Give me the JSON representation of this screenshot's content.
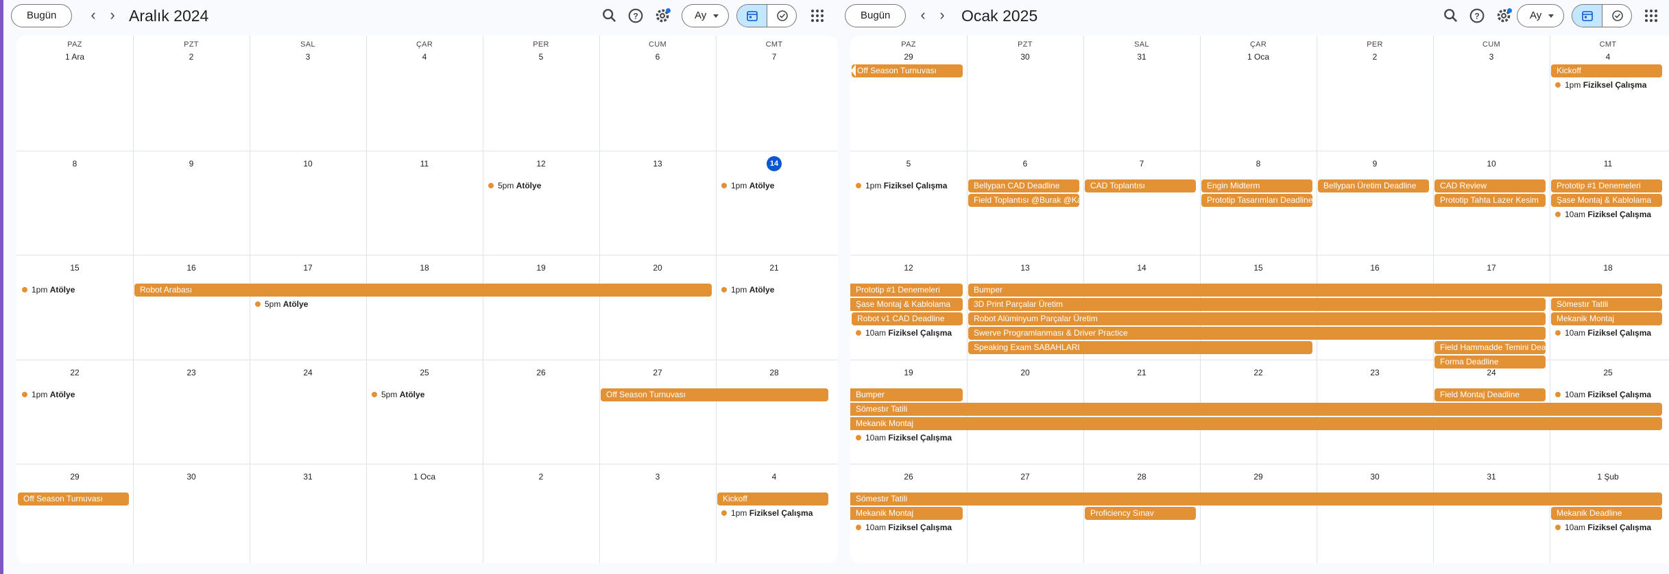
{
  "left": {
    "toolbar": {
      "today_label": "Bugün",
      "month_title": "Aralık 2024",
      "view_label": "Ay",
      "icons": [
        "search-icon",
        "help-icon",
        "settings-icon",
        "calendar-view-icon",
        "tasks-view-icon",
        "apps-grid-icon"
      ]
    },
    "weekdays": [
      "PAZ",
      "PZT",
      "SAL",
      "ÇAR",
      "PER",
      "CUM",
      "CMT"
    ],
    "weeks": [
      [
        "1 Ara",
        "2",
        "3",
        "4",
        "5",
        "6",
        "7"
      ],
      [
        "8",
        "9",
        "10",
        "11",
        "12",
        "13",
        "14"
      ],
      [
        "15",
        "16",
        "17",
        "18",
        "19",
        "20",
        "21"
      ],
      [
        "22",
        "23",
        "24",
        "25",
        "26",
        "27",
        "28"
      ],
      [
        "29",
        "30",
        "31",
        "1 Oca",
        "2",
        "3",
        "4"
      ]
    ],
    "today": {
      "week": 1,
      "day": 6
    },
    "bars": [
      {
        "title": "Robot Arabası",
        "week": 2,
        "start": 1,
        "end": 5,
        "slot": 0
      },
      {
        "title": "Off Season Turnuvası",
        "week": 3,
        "start": 5,
        "end": 6,
        "slot": 0
      },
      {
        "title": "Off Season Turnuvası",
        "week": 4,
        "start": 0,
        "end": 0,
        "slot": 0
      },
      {
        "title": "Kickoff",
        "week": 4,
        "start": 6,
        "end": 6,
        "slot": 0
      }
    ],
    "dots": [
      {
        "time": "5pm",
        "title": "Atölye",
        "week": 1,
        "day": 4,
        "slot": 0
      },
      {
        "time": "1pm",
        "title": "Atölye",
        "week": 1,
        "day": 6,
        "slot": 0
      },
      {
        "time": "1pm",
        "title": "Atölye",
        "week": 2,
        "day": 0,
        "slot": 0
      },
      {
        "time": "5pm",
        "title": "Atölye",
        "week": 2,
        "day": 2,
        "slot": 1
      },
      {
        "time": "1pm",
        "title": "Atölye",
        "week": 2,
        "day": 6,
        "slot": 0
      },
      {
        "time": "1pm",
        "title": "Atölye",
        "week": 3,
        "day": 0,
        "slot": 0
      },
      {
        "time": "5pm",
        "title": "Atölye",
        "week": 3,
        "day": 3,
        "slot": 0
      },
      {
        "time": "1pm",
        "title": "Fiziksel Çalışma",
        "week": 4,
        "day": 6,
        "slot": 1
      }
    ]
  },
  "right": {
    "toolbar": {
      "today_label": "Bugün",
      "month_title": "Ocak 2025",
      "view_label": "Ay",
      "icons": [
        "search-icon",
        "help-icon",
        "settings-icon",
        "calendar-view-icon",
        "tasks-view-icon",
        "apps-grid-icon"
      ]
    },
    "weekdays": [
      "PAZ",
      "PZT",
      "SAL",
      "ÇAR",
      "PER",
      "CUM",
      "CMT"
    ],
    "weeks": [
      [
        "29",
        "30",
        "31",
        "1 Oca",
        "2",
        "3",
        "4"
      ],
      [
        "5",
        "6",
        "7",
        "8",
        "9",
        "10",
        "11"
      ],
      [
        "12",
        "13",
        "14",
        "15",
        "16",
        "17",
        "18"
      ],
      [
        "19",
        "20",
        "21",
        "22",
        "23",
        "24",
        "25"
      ],
      [
        "26",
        "27",
        "28",
        "29",
        "30",
        "31",
        "1 Şub"
      ]
    ],
    "bars": [
      {
        "title": "Off Season Turnuvası",
        "week": 0,
        "start": 0,
        "end": 0,
        "slot": 0,
        "arrow": true
      },
      {
        "title": "Kickoff",
        "week": 0,
        "start": 6,
        "end": 6,
        "slot": 0
      },
      {
        "title": "Bellypan CAD Deadline",
        "week": 1,
        "start": 1,
        "end": 1,
        "slot": 0
      },
      {
        "title": "Field Toplantısı @Burak @Kadir",
        "week": 1,
        "start": 1,
        "end": 1,
        "slot": 1
      },
      {
        "title": "CAD Toplantısı",
        "week": 1,
        "start": 2,
        "end": 2,
        "slot": 0
      },
      {
        "title": "Engin Midterm",
        "week": 1,
        "start": 3,
        "end": 3,
        "slot": 0
      },
      {
        "title": "Prototip Tasarımları Deadline",
        "week": 1,
        "start": 3,
        "end": 3,
        "slot": 1
      },
      {
        "title": "Bellypan Üretim Deadline",
        "week": 1,
        "start": 4,
        "end": 4,
        "slot": 0
      },
      {
        "title": "CAD Review",
        "week": 1,
        "start": 5,
        "end": 5,
        "slot": 0
      },
      {
        "title": "Prototip Tahta Lazer Kesim",
        "week": 1,
        "start": 5,
        "end": 5,
        "slot": 1
      },
      {
        "title": "Prototip #1 Denemeleri",
        "week": 1,
        "start": 6,
        "end": 6,
        "slot": 0
      },
      {
        "title": "Şase Montaj & Kablolama",
        "week": 1,
        "start": 6,
        "end": 6,
        "slot": 1
      },
      {
        "title": "Prototip #1 Denemeleri",
        "week": 2,
        "start": 0,
        "end": 0,
        "slot": 0,
        "contLeft": true
      },
      {
        "title": "Şase Montaj & Kablolama",
        "week": 2,
        "start": 0,
        "end": 0,
        "slot": 1,
        "contLeft": true
      },
      {
        "title": "Robot v1 CAD Deadline",
        "week": 2,
        "start": 0,
        "end": 0,
        "slot": 2
      },
      {
        "title": "Bumper",
        "week": 2,
        "start": 1,
        "end": 6,
        "slot": 0
      },
      {
        "title": "3D Print Parçalar Üretim",
        "week": 2,
        "start": 1,
        "end": 5,
        "slot": 1
      },
      {
        "title": "Robot Alüminyum Parçalar Üretim",
        "week": 2,
        "start": 1,
        "end": 5,
        "slot": 2
      },
      {
        "title": "Swerve Programlanması & Driver Practice",
        "week": 2,
        "start": 1,
        "end": 5,
        "slot": 3
      },
      {
        "title": "Speaking Exam SABAHLARI",
        "week": 2,
        "start": 1,
        "end": 3,
        "slot": 4
      },
      {
        "title": "Field Hammadde Temini Deadline",
        "week": 2,
        "start": 5,
        "end": 5,
        "slot": 4
      },
      {
        "title": "Forma Deadline",
        "week": 2,
        "start": 5,
        "end": 5,
        "slot": 5
      },
      {
        "title": "Sömestır Tatili",
        "week": 2,
        "start": 6,
        "end": 6,
        "slot": 1
      },
      {
        "title": "Mekanik Montaj",
        "week": 2,
        "start": 6,
        "end": 6,
        "slot": 2
      },
      {
        "title": "Bumper",
        "week": 3,
        "start": 0,
        "end": 0,
        "slot": 0,
        "contLeft": true
      },
      {
        "title": "Sömestır Tatili",
        "week": 3,
        "start": 0,
        "end": 6,
        "slot": 1,
        "contLeft": true
      },
      {
        "title": "Mekanik Montaj",
        "week": 3,
        "start": 0,
        "end": 6,
        "slot": 2,
        "contLeft": true
      },
      {
        "title": "Field Montaj Deadline",
        "week": 3,
        "start": 5,
        "end": 5,
        "slot": 0
      },
      {
        "title": "Sömestır Tatili",
        "week": 4,
        "start": 0,
        "end": 6,
        "slot": 0,
        "contLeft": true
      },
      {
        "title": "Mekanik Montaj",
        "week": 4,
        "start": 0,
        "end": 0,
        "slot": 1,
        "contLeft": true
      },
      {
        "title": "Proficiency Sınav",
        "week": 4,
        "start": 2,
        "end": 2,
        "slot": 1
      },
      {
        "title": "Mekanik Deadline",
        "week": 4,
        "start": 6,
        "end": 6,
        "slot": 1
      }
    ],
    "dots": [
      {
        "time": "1pm",
        "title": "Fiziksel Çalışma",
        "week": 0,
        "day": 6,
        "slot": 1
      },
      {
        "time": "1pm",
        "title": "Fiziksel Çalışma",
        "week": 1,
        "day": 0,
        "slot": 0
      },
      {
        "time": "10am",
        "title": "Fiziksel Çalışma",
        "week": 1,
        "day": 6,
        "slot": 2
      },
      {
        "time": "10am",
        "title": "Fiziksel Çalışma",
        "week": 2,
        "day": 0,
        "slot": 3
      },
      {
        "time": "10am",
        "title": "Fiziksel Çalışma",
        "week": 2,
        "day": 6,
        "slot": 3
      },
      {
        "time": "10am",
        "title": "Fiziksel Çalışma",
        "week": 3,
        "day": 0,
        "slot": 3
      },
      {
        "time": "10am",
        "title": "Fiziksel Çalışma",
        "week": 3,
        "day": 6,
        "slot": 0
      },
      {
        "time": "10am",
        "title": "Fiziksel Çalışma",
        "week": 4,
        "day": 0,
        "slot": 2
      },
      {
        "time": "10am",
        "title": "Fiziksel Çalışma",
        "week": 4,
        "day": 6,
        "slot": 2
      }
    ]
  },
  "colors": {
    "event": "#e39135",
    "today": "#0b57d0",
    "grid": "#dde3ea",
    "selected_view": "#c2e7ff"
  }
}
